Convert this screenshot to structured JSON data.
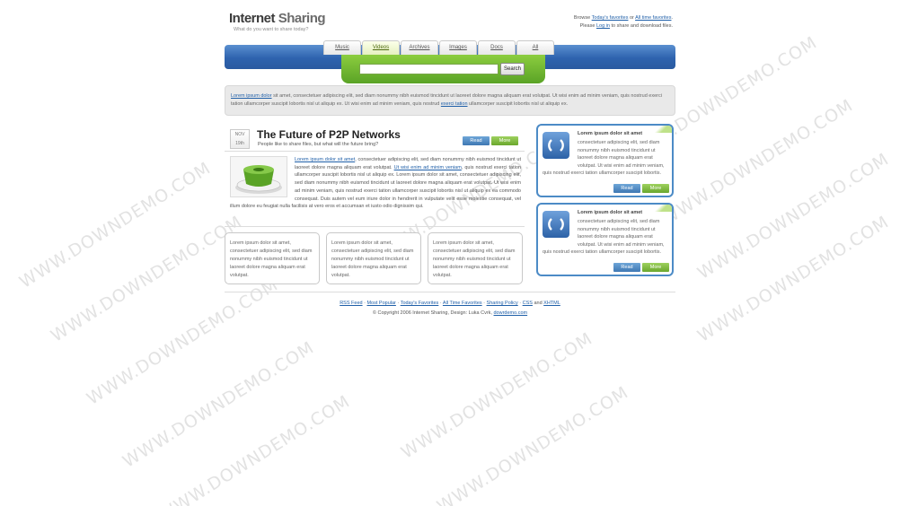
{
  "header": {
    "logo_part1": "Internet ",
    "logo_part2": "Sharing",
    "tagline": "What do you want to share today?",
    "browse_prefix": "Browse ",
    "todays_favorites": "Today's favorites",
    "or": " or ",
    "all_time_favorites": "All time favorites",
    "please": "Please ",
    "login": "Log in",
    "login_suffix": " to share and download files."
  },
  "tabs": [
    {
      "label": "Music"
    },
    {
      "label": "Videos",
      "active": true
    },
    {
      "label": "Archives"
    },
    {
      "label": "Images"
    },
    {
      "label": "Docs"
    },
    {
      "label": "All"
    }
  ],
  "search": {
    "value": "",
    "button": "Search"
  },
  "intro": {
    "link": "Lorem ipsum dolor",
    "text1": " sit amet, consectetuer adipiscing elit, sed diam nonummy nibh euismod tincidunt ut laoreet dolore magna aliquam erat volutpat. Ut wisi enim ad minim veniam, quis nostrud exerci tation ullamcorper suscipit lobortis nisl ut aliquip ex. Ut wisi enim ad minim veniam, quis nostrud ",
    "link2": "exerci tation",
    "text2": " ullamcorper suscipit lobortis nisl ut aliquip ex."
  },
  "article": {
    "date_month": "NOV",
    "date_day": "19th",
    "title": "The Future of P2P Networks",
    "subtitle": "People like to share files, but what will the future bring?",
    "read": "Read",
    "more": "More",
    "link1": "Lorem ipsum dolor sit amet",
    "text1": ", consectetuer adipiscing elit, sed diam nonummy nibh euismod tincidunt ut laoreet dolore magna aliquam erat volutpat. ",
    "link2": "Ut wisi enim ad minim veniam",
    "text2": ", quis nostrud exerci tation ullamcorper suscipit lobortis nisl ut aliquip ex. Lorem ipsum dolor sit amet, consectetuer adipiscing elit, sed diam nonummy nibh euismod tincidunt ut laoreet dolore magna aliquam erat volutpat. Ut wisi enim ad minim veniam, quis nostrud exerci tation ullamcorper suscipit lobortis nisl ut aliquip ex ea commodo consequat. Duis autem vel eum iriure dolor in hendrerit in vulputate velit esse molestie consequat, vel illum dolore eu feugiat nulla facilisis at vero eros et accumsan et iusto odio dignissim qui."
  },
  "mini_boxes": [
    {
      "text": "Lorem ipsum dolor sit amet, consectetuer adipiscing elit, sed diam nonummy nibh euismod tincidunt ut laoreet dolore magna aliquam erat volutpat."
    },
    {
      "text": "Lorem ipsum dolor sit amet, consectetuer adipiscing elit, sed diam nonummy nibh euismod tincidunt ut laoreet dolore magna aliquam erat volutpat."
    },
    {
      "text": "Lorem ipsum dolor sit amet, consectetuer adipiscing elit, sed diam nonummy nibh euismod tincidunt ut laoreet dolore magna aliquam erat volutpat."
    }
  ],
  "side_boxes": [
    {
      "heading": "Lorem ipsum dolor sit amet",
      "text": "consectetuer adipiscing elit, sed diam nonummy nibh euismod tincidunt ut laoreet dolore magna aliquam erat volutpat. Ut wisi enim ad minim veniam, quis nostrud exerci tation ullamcorper suscipit lobortis.",
      "read": "Read",
      "more": "More"
    },
    {
      "heading": "Lorem ipsum dolor sit amet",
      "text": "consectetuer adipiscing elit, sed diam nonummy nibh euismod tincidunt ut laoreet dolore magna aliquam erat volutpat. Ut wisi enim ad minim veniam, quis nostrud exerci tation ullamcorper suscipit lobortis.",
      "read": "Read",
      "more": "More"
    }
  ],
  "footer": {
    "links": [
      "RSS Feed",
      "Most Popular",
      "Today's Favorites",
      "All Time Favorites",
      "Sharing Policy",
      "CSS",
      "XHTML"
    ],
    "sep": "·",
    "and": " and ",
    "copyright_text": "© Copyright 2006 Internet Sharing, Design: Luka Cvrk, ",
    "credit_link": "dowrdemo.com"
  },
  "watermark": "WWW.DOWNDEMO.COM",
  "colors": {
    "band_blue": "#2e63ae",
    "search_green": "#6fb22f",
    "read_blue": "#3f78b3",
    "more_green": "#6aa72d",
    "link": "#1f5fa8"
  }
}
